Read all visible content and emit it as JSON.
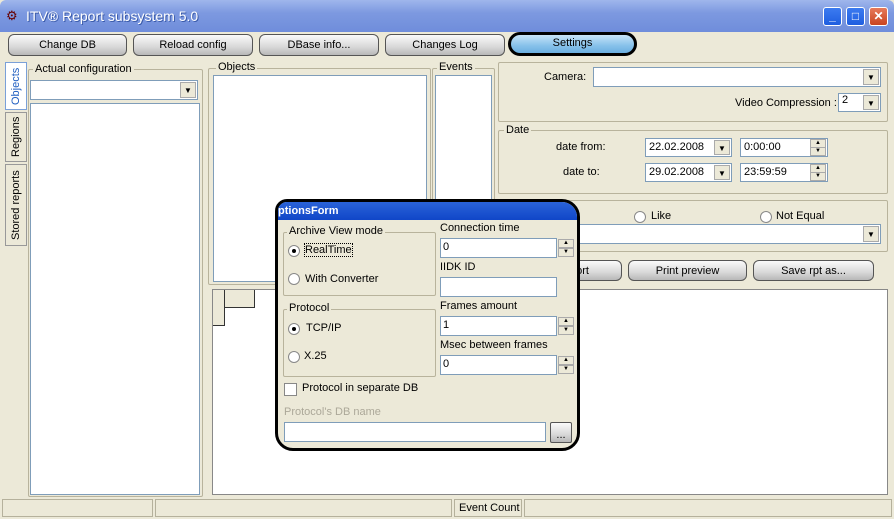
{
  "window": {
    "title": "ITV® Report subsystem 5.0",
    "minimize": "_",
    "maximize": "□",
    "close": "✕"
  },
  "toolbar": {
    "change_db": "Change DB",
    "reload_config": "Reload config",
    "dbase_info": "DBase info...",
    "changes_log": "Changes Log",
    "settings": "Settings"
  },
  "side_tabs": [
    "Objects",
    "Regions",
    "Stored reports"
  ],
  "actual_config": {
    "label": "Actual configuration",
    "value": ""
  },
  "objects": {
    "label": "Objects"
  },
  "events": {
    "label": "Events"
  },
  "filter": {
    "camera_label": "Camera:",
    "camera_value": "",
    "video_compression_label": "Video Compression :",
    "video_compression_value": "2"
  },
  "date": {
    "label": "Date",
    "from_label": "date from:",
    "from_date": "22.02.2008",
    "from_time": "0:00:00",
    "to_label": "date to:",
    "to_date": "29.02.2008",
    "to_time": "23:59:59"
  },
  "match": {
    "like": "Like",
    "not_equal": "Not Equal",
    "value": ""
  },
  "actions": {
    "report": "ort",
    "print_preview": "Print preview",
    "save_rpt": "Save rpt as..."
  },
  "status": {
    "event_count": "Event Count"
  },
  "dialog": {
    "title": "ptionsForm",
    "archive_view_mode": "Archive View mode",
    "realtime": "RealTime",
    "with_converter": "With Converter",
    "protocol": "Protocol",
    "tcpip": "TCP/IP",
    "x25": "X.25",
    "connection_time_label": "Connection time",
    "connection_time": "0",
    "iidk_id_label": "IIDK ID",
    "iidk_id": "",
    "frames_amount_label": "Frames amount",
    "frames_amount": "1",
    "msec_label": "Msec between frames",
    "msec": "0",
    "protocol_separate_db": "Protocol in separate DB",
    "protocol_db_name_label": "Protocol's DB name",
    "protocol_db_name": "",
    "browse": "..."
  }
}
